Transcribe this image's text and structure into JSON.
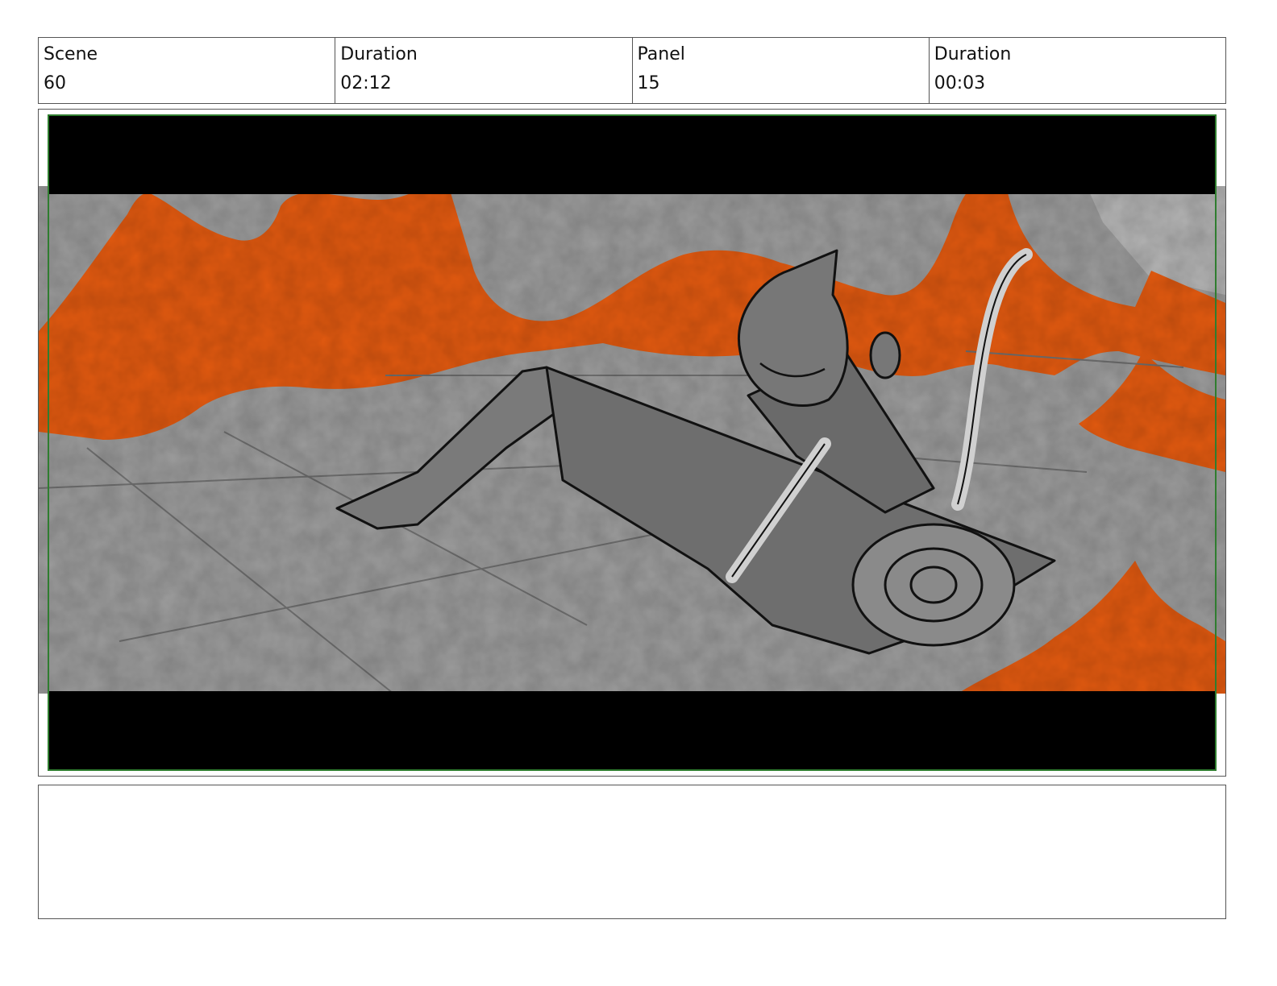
{
  "header": {
    "scene_label": "Scene",
    "scene_value": "60",
    "scene_duration_label": "Duration",
    "scene_duration_value": "02:12",
    "panel_label": "Panel",
    "panel_value": "15",
    "panel_duration_label": "Duration",
    "panel_duration_value": "00:03"
  },
  "colors": {
    "lava": "#e35a10",
    "floor": "#9c9c9c",
    "letterbox": "#000000",
    "safe_frame": "#2f7d2f",
    "character": "#6e6e6e"
  },
  "notes": {
    "text": ""
  }
}
